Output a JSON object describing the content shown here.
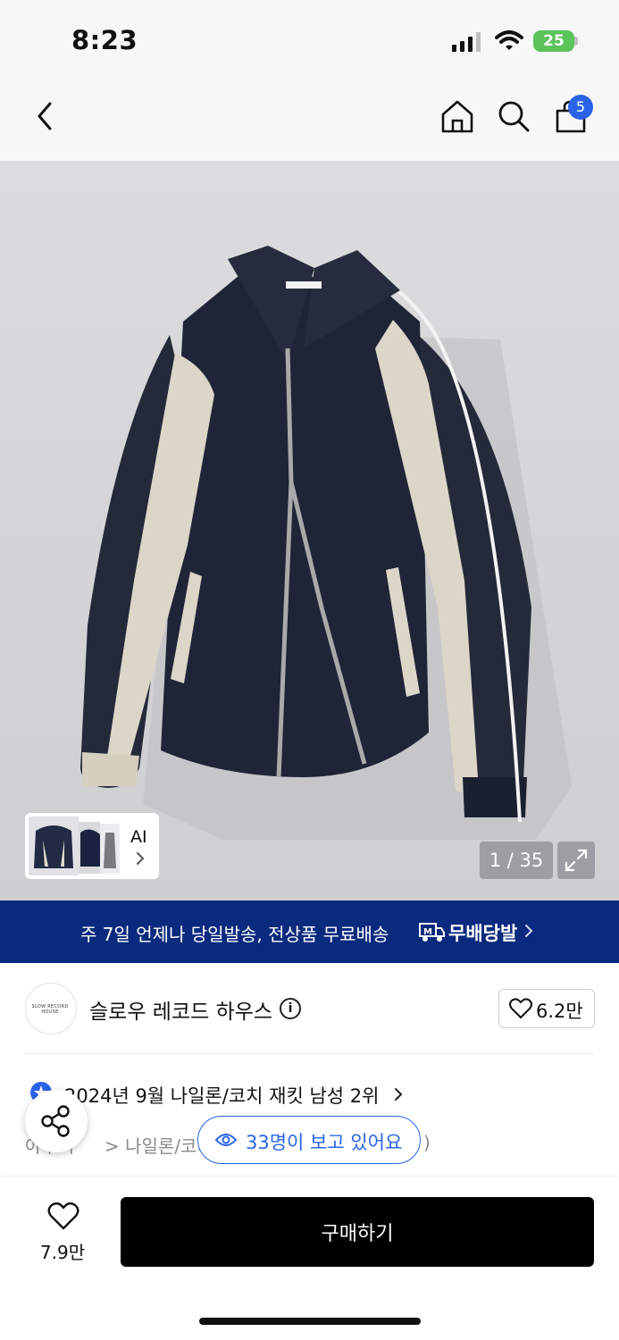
{
  "status_bar": {
    "time": "8:23",
    "battery": "25"
  },
  "header": {
    "cart_count": "5"
  },
  "gallery": {
    "ai_label": "AI",
    "page_counter": "1 / 35"
  },
  "banner": {
    "text": "주 7일 언제나 당일발송, 전상품 무료배송",
    "brand": "무배당발"
  },
  "shop": {
    "logo_text": "SLOW RECORD HOUSE",
    "name": "슬로우 레코드 하우스",
    "likes": "6.2만"
  },
  "ranking": {
    "text": "2024년 9월 나일론/코치 재킷 남성 2위"
  },
  "breadcrumb": {
    "part1": "아우터",
    "part2": "> 나일론/코치",
    "part3": ")"
  },
  "viewers": {
    "text": "33명이 보고 있어요"
  },
  "bottom_bar": {
    "wish_count": "7.9만",
    "buy_label": "구매하기"
  },
  "colors": {
    "accent": "#2a63e8",
    "banner": "#0a2a7e",
    "buy_button": "#000000"
  }
}
